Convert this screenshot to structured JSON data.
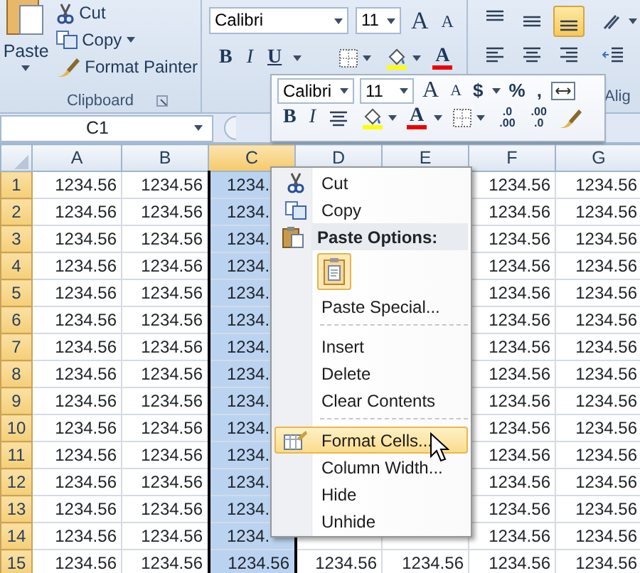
{
  "ribbon": {
    "clipboard": {
      "paste": "Paste",
      "cut": "Cut",
      "copy": "Copy",
      "format_painter": "Format Painter",
      "label": "Clipboard"
    },
    "font": {
      "font_name": "Calibri",
      "font_size": "11",
      "grow_font": "A",
      "shrink_font": "A",
      "bold": "B",
      "italic": "I",
      "underline": "U",
      "font_color": "A"
    },
    "alignment": {
      "vertical_align": [
        {
          "selected": false
        },
        {
          "selected": false
        },
        {
          "selected": true
        }
      ],
      "label": "Alig"
    }
  },
  "mini_toolbar": {
    "font_name": "Calibri",
    "font_size": "11",
    "grow_font": "A",
    "shrink_font": "A",
    "currency": "$",
    "percent": "%",
    "comma": ",",
    "bold": "B",
    "italic": "I",
    "font_color": "A",
    "increase_decimal": [
      ".0",
      ".00"
    ],
    "decrease_decimal": [
      ".00",
      ".0"
    ]
  },
  "name_box": {
    "value": "C1"
  },
  "grid": {
    "columns": [
      {
        "label": "A",
        "selected": false
      },
      {
        "label": "B",
        "selected": false
      },
      {
        "label": "C",
        "selected": true
      },
      {
        "label": "D",
        "selected": false
      },
      {
        "label": "E",
        "selected": false
      },
      {
        "label": "F",
        "selected": false
      },
      {
        "label": "G",
        "selected": false
      }
    ],
    "rows": [
      {
        "number": "1",
        "left_cells": [
          "1234.56",
          "1234.56",
          "1234."
        ],
        "right_cells": [
          "1234.56",
          "1234.56"
        ]
      },
      {
        "number": "2",
        "left_cells": [
          "1234.56",
          "1234.56",
          "1234."
        ],
        "right_cells": [
          "1234.56",
          "1234.56"
        ]
      },
      {
        "number": "3",
        "left_cells": [
          "1234.56",
          "1234.56",
          "1234."
        ],
        "right_cells": [
          "1234.56",
          "1234.56"
        ]
      },
      {
        "number": "4",
        "left_cells": [
          "1234.56",
          "1234.56",
          "1234."
        ],
        "right_cells": [
          "1234.56",
          "1234.56"
        ]
      },
      {
        "number": "5",
        "left_cells": [
          "1234.56",
          "1234.56",
          "1234."
        ],
        "right_cells": [
          "1234.56",
          "1234.56"
        ]
      },
      {
        "number": "6",
        "left_cells": [
          "1234.56",
          "1234.56",
          "1234."
        ],
        "right_cells": [
          "1234.56",
          "1234.56"
        ]
      },
      {
        "number": "7",
        "left_cells": [
          "1234.56",
          "1234.56",
          "1234."
        ],
        "right_cells": [
          "1234.56",
          "1234.56"
        ]
      },
      {
        "number": "8",
        "left_cells": [
          "1234.56",
          "1234.56",
          "1234."
        ],
        "right_cells": [
          "1234.56",
          "1234.56"
        ]
      },
      {
        "number": "9",
        "left_cells": [
          "1234.56",
          "1234.56",
          "1234."
        ],
        "right_cells": [
          "1234.56",
          "1234.56"
        ]
      },
      {
        "number": "10",
        "left_cells": [
          "1234.56",
          "1234.56",
          "1234."
        ],
        "right_cells": [
          "1234.56",
          "1234.56"
        ]
      },
      {
        "number": "11",
        "left_cells": [
          "1234.56",
          "1234.56",
          "1234."
        ],
        "right_cells": [
          "1234.56",
          "1234.56"
        ]
      },
      {
        "number": "12",
        "left_cells": [
          "1234.56",
          "1234.56",
          "1234."
        ],
        "right_cells": [
          "1234.56",
          "1234.56"
        ]
      },
      {
        "number": "13",
        "left_cells": [
          "1234.56",
          "1234.56",
          "1234."
        ],
        "right_cells": [
          "1234.56",
          "1234.56"
        ]
      },
      {
        "number": "14",
        "left_cells": [
          "1234.56",
          "1234.56",
          "1234."
        ],
        "right_cells": [
          "1234.56",
          "1234.56"
        ]
      },
      {
        "number": "15",
        "cells": [
          "1234.56",
          "1234.56",
          "1234.56",
          "1234.56",
          "1234.56",
          "1234.56",
          "1234.56"
        ]
      }
    ]
  },
  "context_menu": {
    "items": [
      {
        "kind": "command",
        "label": "Cut",
        "selected": false
      },
      {
        "kind": "command",
        "label": "Copy",
        "selected": false
      },
      {
        "kind": "header",
        "label": "Paste Options:"
      },
      {
        "kind": "paste_option"
      },
      {
        "kind": "command",
        "label": "Paste Special...",
        "selected": false
      },
      {
        "kind": "command",
        "label": "Insert",
        "selected": false,
        "separator_before": true
      },
      {
        "kind": "command",
        "label": "Delete",
        "selected": false
      },
      {
        "kind": "command",
        "label": "Clear Contents",
        "selected": false
      },
      {
        "kind": "command",
        "label": "Format Cells...",
        "selected": true,
        "separator_before": true
      },
      {
        "kind": "command",
        "label": "Column Width...",
        "selected": false
      },
      {
        "kind": "command",
        "label": "Hide",
        "selected": false
      },
      {
        "kind": "command",
        "label": "Unhide",
        "selected": false
      }
    ]
  }
}
